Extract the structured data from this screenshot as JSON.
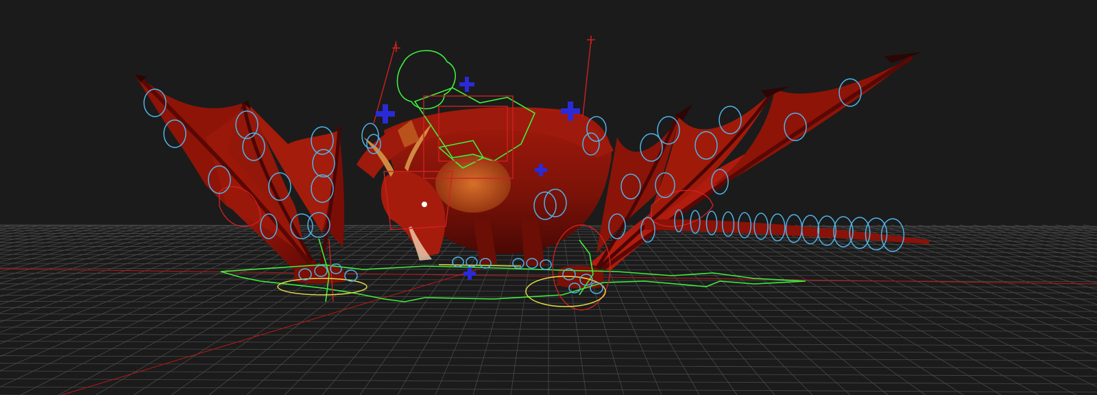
{
  "viewport": {
    "background_color": "#1b1b1b",
    "grid_color": "#4a4a4a",
    "axis_color": "#c01818",
    "model": "red dragon rig",
    "control_colors": {
      "fk_control": "#4fb4e8",
      "ik_control": "#3ef03e",
      "root_control": "#e8e04a",
      "pivot_control": "#d02020",
      "joint_locator": "#2a2ad8"
    }
  }
}
